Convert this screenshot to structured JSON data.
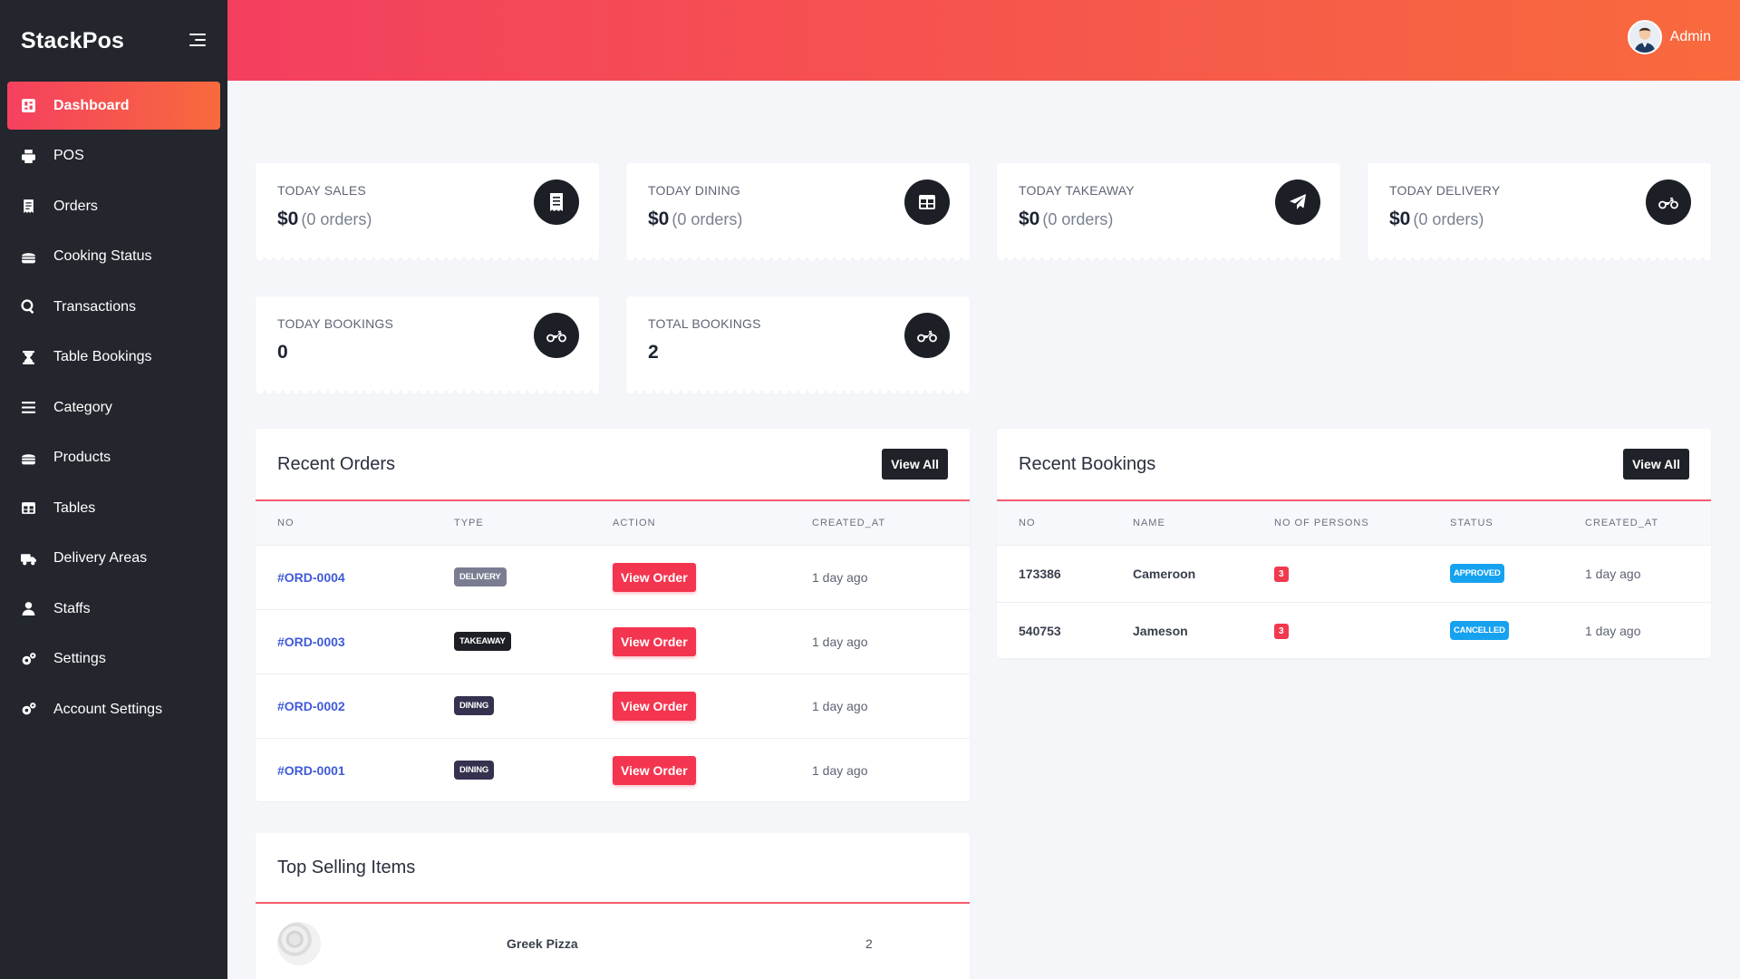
{
  "sidebar": {
    "brand": "StackPos",
    "items": [
      {
        "label": "Dashboard",
        "icon": "dashboard-icon",
        "active": true
      },
      {
        "label": "POS",
        "icon": "printer-icon"
      },
      {
        "label": "Orders",
        "icon": "receipt-icon"
      },
      {
        "label": "Cooking Status",
        "icon": "burger-icon"
      },
      {
        "label": "Transactions",
        "icon": "search-dollar-icon"
      },
      {
        "label": "Table Bookings",
        "icon": "hourglass-icon"
      },
      {
        "label": "Category",
        "icon": "list-icon"
      },
      {
        "label": "Products",
        "icon": "burger-icon"
      },
      {
        "label": "Tables",
        "icon": "table-icon"
      },
      {
        "label": "Delivery Areas",
        "icon": "truck-icon"
      },
      {
        "label": "Staffs",
        "icon": "user-icon"
      },
      {
        "label": "Settings",
        "icon": "cogs-icon"
      },
      {
        "label": "Account Settings",
        "icon": "cogs-icon"
      }
    ]
  },
  "topbar": {
    "user_name": "Admin"
  },
  "stats": [
    {
      "label": "TODAY SALES",
      "value": "$0",
      "sub": "(0 orders)",
      "icon": "receipt-icon"
    },
    {
      "label": "TODAY DINING",
      "value": "$0",
      "sub": "(0 orders)",
      "icon": "table-icon"
    },
    {
      "label": "TODAY TAKEAWAY",
      "value": "$0",
      "sub": "(0 orders)",
      "icon": "paper-plane-icon"
    },
    {
      "label": "TODAY DELIVERY",
      "value": "$0",
      "sub": "(0 orders)",
      "icon": "motorcycle-icon"
    },
    {
      "label": "TODAY BOOKINGS",
      "value": "0",
      "sub": "",
      "icon": "motorcycle-icon"
    },
    {
      "label": "TOTAL BOOKINGS",
      "value": "2",
      "sub": "",
      "icon": "motorcycle-icon"
    }
  ],
  "recent_orders": {
    "title": "Recent Orders",
    "view_all": "View All",
    "columns": [
      "NO",
      "TYPE",
      "ACTION",
      "CREATED_AT"
    ],
    "rows": [
      {
        "no": "#ORD-0004",
        "type": "DELIVERY",
        "type_key": "delivery",
        "action": "View Order",
        "created": "1 day ago"
      },
      {
        "no": "#ORD-0003",
        "type": "TAKEAWAY",
        "type_key": "takeaway",
        "action": "View Order",
        "created": "1 day ago"
      },
      {
        "no": "#ORD-0002",
        "type": "DINING",
        "type_key": "dining",
        "action": "View Order",
        "created": "1 day ago"
      },
      {
        "no": "#ORD-0001",
        "type": "DINING",
        "type_key": "dining",
        "action": "View Order",
        "created": "1 day ago"
      }
    ]
  },
  "recent_bookings": {
    "title": "Recent Bookings",
    "view_all": "View All",
    "columns": [
      "NO",
      "NAME",
      "NO OF PERSONS",
      "STATUS",
      "CREATED_AT"
    ],
    "rows": [
      {
        "no": "173386",
        "name": "Cameroon",
        "persons": "3",
        "status": "APPROVED",
        "created": "1 day ago"
      },
      {
        "no": "540753",
        "name": "Jameson",
        "persons": "3",
        "status": "CANCELLED",
        "created": "1 day ago"
      }
    ]
  },
  "top_selling": {
    "title": "Top Selling Items",
    "items": [
      {
        "name": "Greek Pizza",
        "qty": "2"
      }
    ]
  },
  "colors": {
    "accent_start": "#f43f5f",
    "accent_end": "#f86a3d",
    "sidebar_bg": "#23262d",
    "link": "#3f5ad8",
    "danger": "#f4354f",
    "info": "#17a2f0"
  }
}
